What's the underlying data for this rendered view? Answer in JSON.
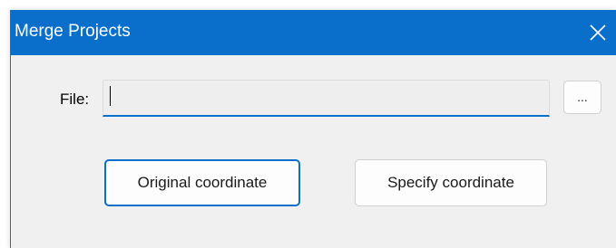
{
  "window": {
    "title": "Merge Projects",
    "close_icon": "close-icon"
  },
  "form": {
    "file_label": "File:",
    "file_value": "",
    "browse_label": "..."
  },
  "buttons": {
    "original_label": "Original coordinate",
    "specify_label": "Specify coordinate"
  },
  "colors": {
    "titlebar": "#0a6fcb",
    "dialog_bg": "#f0f0f0",
    "accent": "#0a6fcb"
  }
}
